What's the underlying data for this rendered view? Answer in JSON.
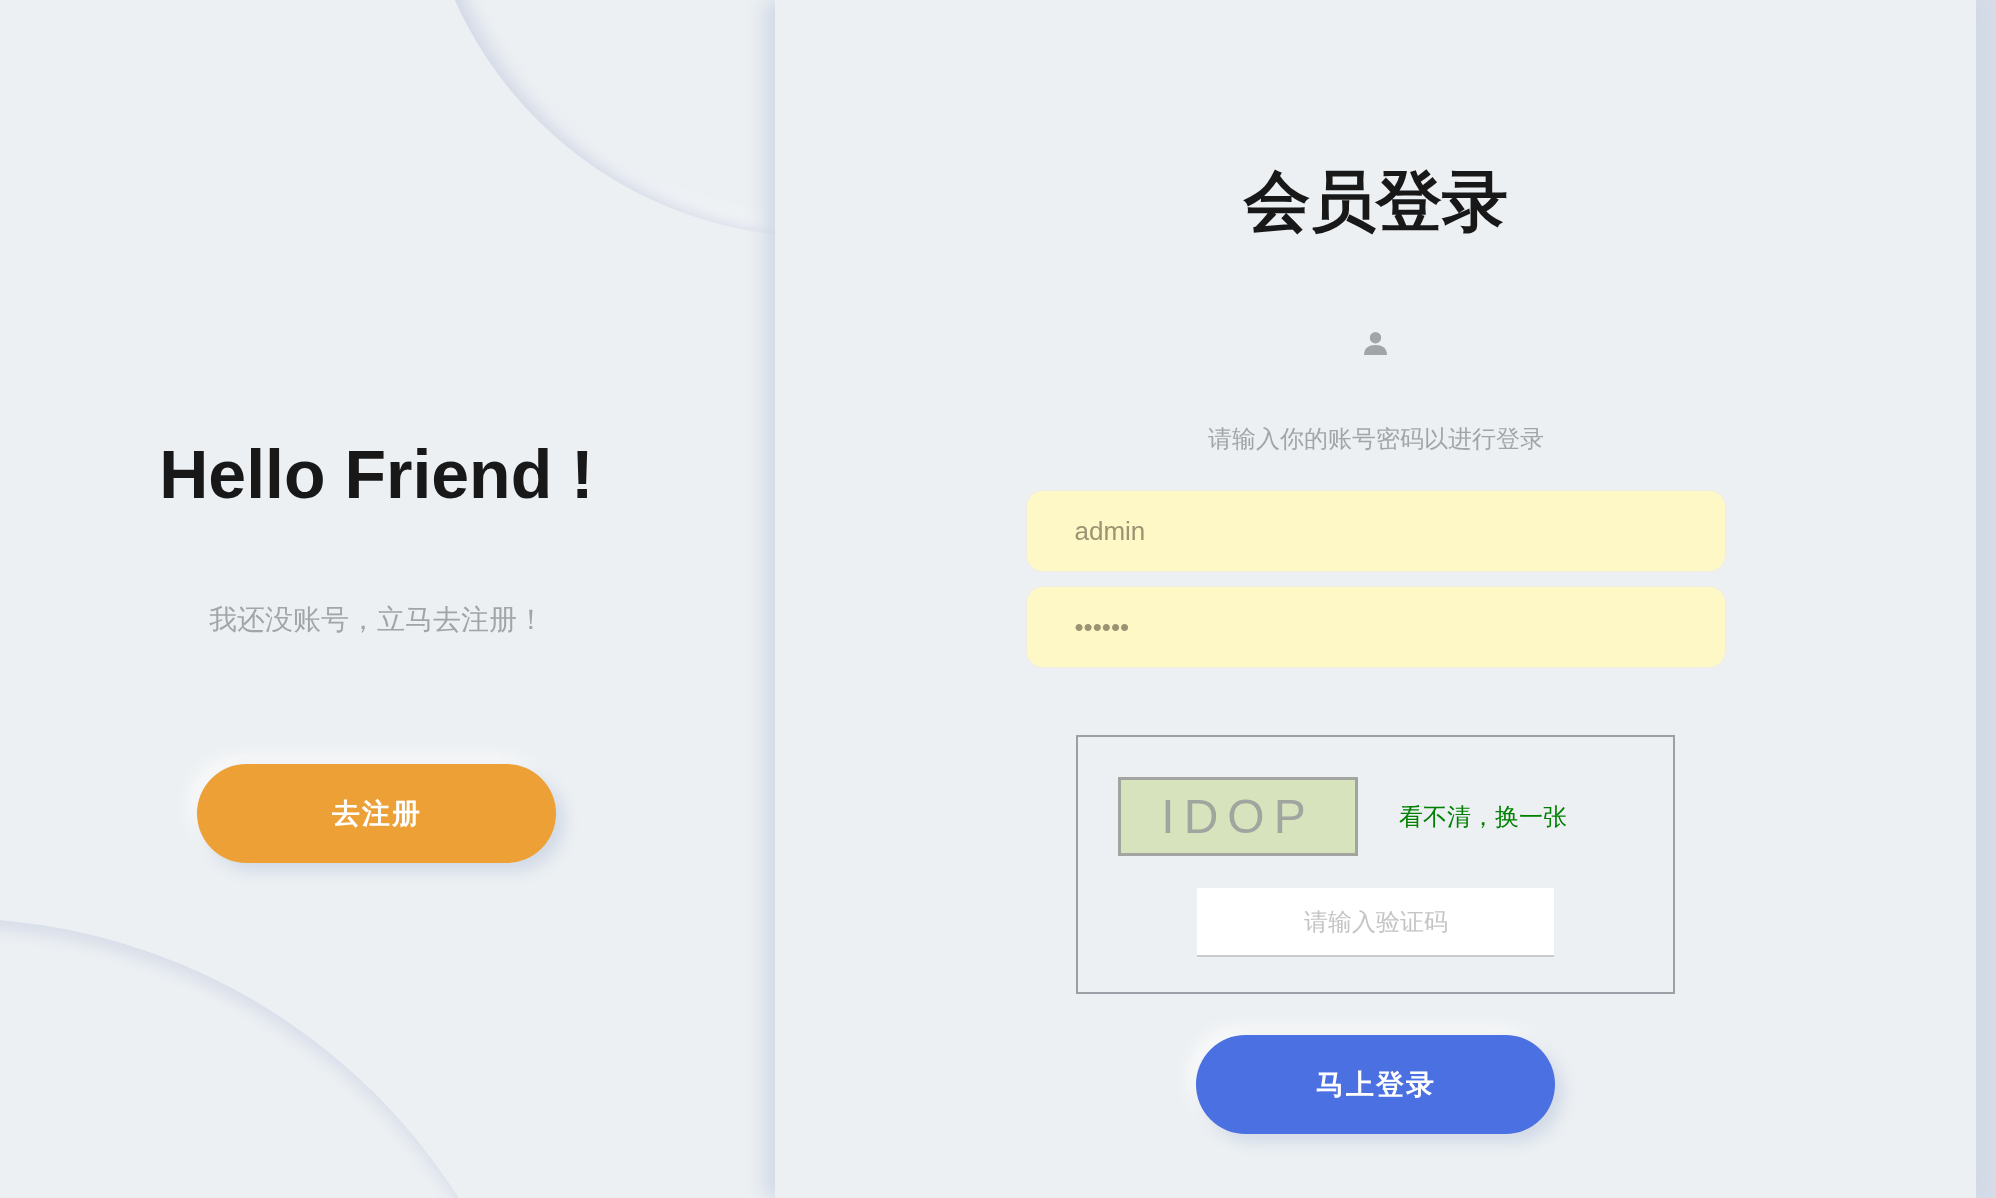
{
  "welcome_panel": {
    "title": "Hello Friend !",
    "subtitle": "我还没账号，立马去注册！",
    "button": "去注册"
  },
  "login_panel": {
    "title": "会员登录",
    "hint": "请输入你的账号密码以进行登录",
    "username": {
      "value": "admin",
      "autofilled": true
    },
    "password": {
      "value": "••••••",
      "autofilled": true
    },
    "captcha": {
      "code": "IDOP",
      "refresh_link": "看不清，换一张",
      "input": {
        "placeholder": "请输入验证码"
      }
    },
    "button": "马上登录"
  }
}
